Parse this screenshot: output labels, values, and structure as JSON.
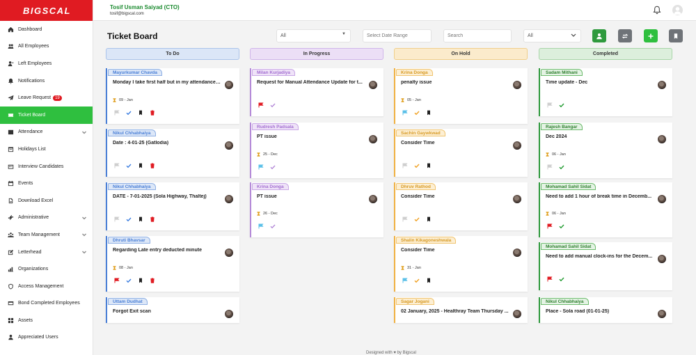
{
  "app": {
    "logo_text": "BIGSCAL"
  },
  "user": {
    "name": "Tosif Usman Saiyad (CTO)",
    "email": "tosif@bigscal.com"
  },
  "sidebar": {
    "items": [
      {
        "label": "Dashboard",
        "icon": "home-icon"
      },
      {
        "label": "All Employees",
        "icon": "users-icon"
      },
      {
        "label": "Left Employees",
        "icon": "user-minus-icon"
      },
      {
        "label": "Notifications",
        "icon": "bell-icon"
      },
      {
        "label": "Leave Request",
        "icon": "plane-icon",
        "badge": "19"
      },
      {
        "label": "Ticket Board",
        "icon": "ticket-icon",
        "active": true
      },
      {
        "label": "Attendance",
        "icon": "calendar-grid-icon",
        "expandable": true
      },
      {
        "label": "Holidays List",
        "icon": "holiday-icon"
      },
      {
        "label": "Interview Candidates",
        "icon": "id-card-icon"
      },
      {
        "label": "Events",
        "icon": "event-icon"
      },
      {
        "label": "Download Excel",
        "icon": "download-icon"
      },
      {
        "label": "Administrative",
        "icon": "gear-icon",
        "expandable": true
      },
      {
        "label": "Team Management",
        "icon": "team-icon",
        "expandable": true
      },
      {
        "label": "Letterhead",
        "icon": "edit-icon",
        "expandable": true
      },
      {
        "label": "Organizations",
        "icon": "chart-icon"
      },
      {
        "label": "Access Management",
        "icon": "shield-icon"
      },
      {
        "label": "Bond Completed Employees",
        "icon": "card-icon"
      },
      {
        "label": "Assets",
        "icon": "grid-icon"
      },
      {
        "label": "Appreciated Users",
        "icon": "user-star-icon"
      }
    ]
  },
  "board": {
    "title": "Ticket Board",
    "filter_all_1": "All",
    "date_placeholder": "Select Date Range",
    "search_placeholder": "Search",
    "filter_all_2": "All"
  },
  "colors": {
    "accent": "#2fbf3f",
    "brand": "#e01b22",
    "todo": "#4a7fd6",
    "progress": "#b48ad8",
    "hold": "#f0b040",
    "done": "#2f9a3e"
  },
  "columns": [
    {
      "title": "To Do",
      "cards": [
        {
          "assignee": "Mayurkumar Chavda",
          "title": "Monday I take first half but in my attendance ...",
          "due": "09 - Jan",
          "flag": "grey",
          "check": "blue",
          "bookmark": true,
          "trash": true
        },
        {
          "assignee": "Nikul Chhabhaiya",
          "title": "Date : 4-01-25 (Gatlodia)",
          "due": "",
          "flag": "grey",
          "check": "blue",
          "bookmark": true,
          "trash": true
        },
        {
          "assignee": "Nikul Chhabhaiya",
          "title": "DATE - 7-01-2025 (Sola Highway, Thaltej)",
          "due": "",
          "flag": "grey",
          "check": "blue",
          "bookmark": true,
          "trash": true
        },
        {
          "assignee": "Dhruti Bhavsar",
          "title": "Regarding Late entry deducted minute",
          "due": "08 - Jan",
          "flag": "red",
          "check": "blue",
          "bookmark": true,
          "trash": true
        },
        {
          "assignee": "Uttam Dudhat",
          "title": "Forgot Exit scan",
          "due": "",
          "flag": "",
          "check": "",
          "bookmark": false,
          "trash": false
        }
      ]
    },
    {
      "title": "In Progress",
      "cards": [
        {
          "assignee": "Milan Kurjadiya",
          "title": "Request for Manual Attendance Update for t...",
          "due": "",
          "flag": "red",
          "check": "purple"
        },
        {
          "assignee": "Rudresh Padsala",
          "title": "PT issue",
          "due": "25 - Dec",
          "flag": "blue",
          "check": "purple"
        },
        {
          "assignee": "Krina Donga",
          "title": "PT issue",
          "due": "26 - Dec",
          "flag": "blue",
          "check": "purple"
        }
      ]
    },
    {
      "title": "On Hold",
      "cards": [
        {
          "assignee": "Krina Donga",
          "title": "penalty issue",
          "due": "05 - Jan",
          "flag": "blue",
          "check": "orange",
          "bookmark": true
        },
        {
          "assignee": "Sachin Gaywkwad",
          "title": "Consider Time",
          "due": "",
          "flag": "grey",
          "check": "orange",
          "bookmark": true
        },
        {
          "assignee": "Dhruv Rathod",
          "title": "Consider Time",
          "due": "",
          "flag": "grey",
          "check": "orange",
          "bookmark": true
        },
        {
          "assignee": "Shalin Kikagoneshwala",
          "title": "Consider Time",
          "due": "31 - Jan",
          "flag": "blue",
          "check": "orange",
          "bookmark": true
        },
        {
          "assignee": "Sagar Jogani",
          "title": "02 January, 2025 - Healthray Team Thursday ...",
          "due": "",
          "flag": "",
          "check": ""
        }
      ]
    },
    {
      "title": "Completed",
      "cards": [
        {
          "assignee": "Sadam Mithani",
          "title": "Time update - Dec",
          "due": "",
          "flag": "grey",
          "check": "green"
        },
        {
          "assignee": "Rajesh Bangar",
          "title": "Dec 2024",
          "due": "06 - Jan",
          "flag": "grey",
          "check": "green"
        },
        {
          "assignee": "Mohamad Sahil Sidat",
          "title": "Need to add 1 hour of break time in Decemb...",
          "due": "06 - Jan",
          "flag": "red",
          "check": "green"
        },
        {
          "assignee": "Mohamad Sahil Sidat",
          "title": "Need to add manual clock-ins for the Decem...",
          "due": "",
          "flag": "red",
          "check": "green"
        },
        {
          "assignee": "Nikul Chhabhaiya",
          "title": "Place - Sola road (01-01-25)",
          "due": "",
          "flag": "",
          "check": ""
        }
      ]
    }
  ],
  "footer": {
    "text": "Designed with ♥ by Bigscal"
  }
}
